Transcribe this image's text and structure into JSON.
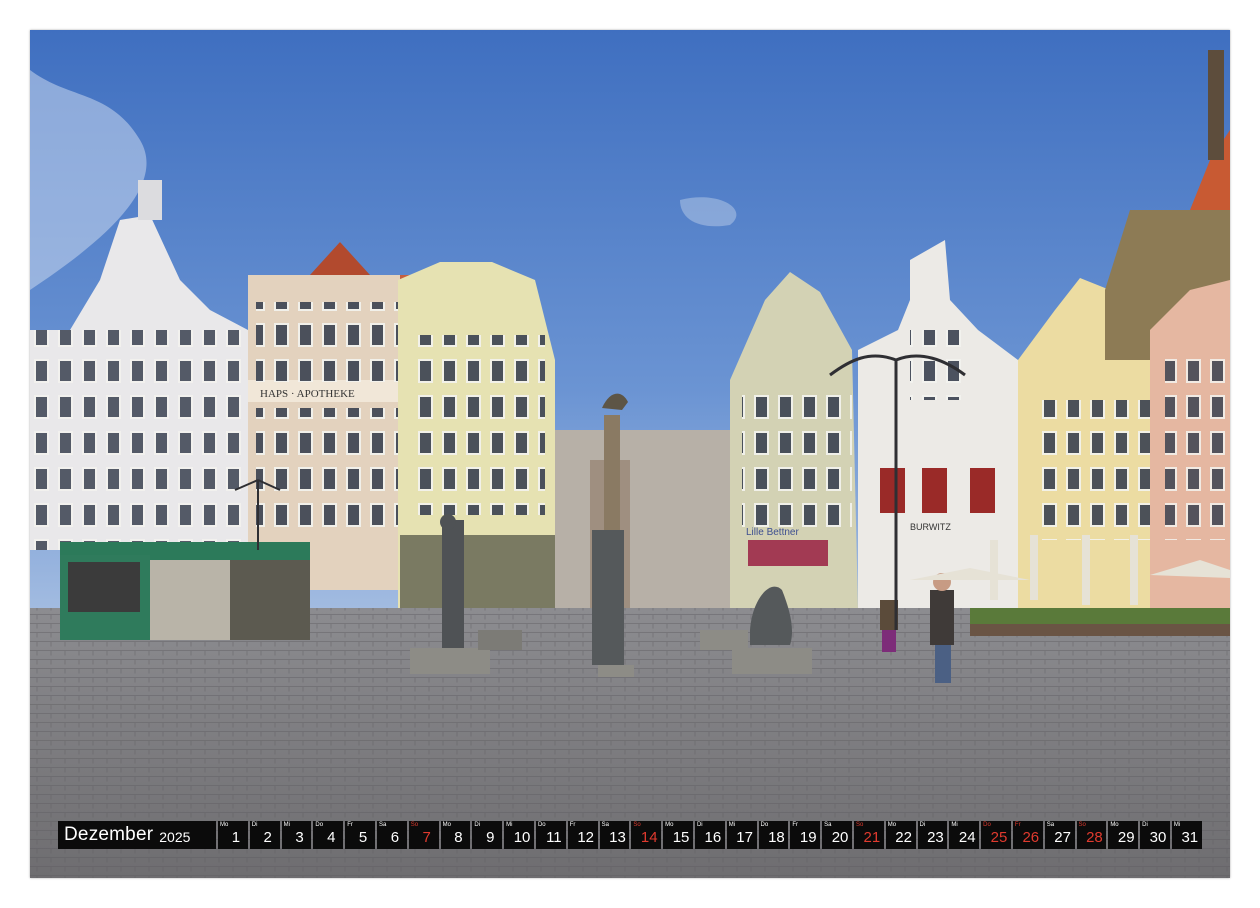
{
  "photo": {
    "scene_icon": "rostock-neuer-markt-photo",
    "shop_signs": [
      "HAPS · APOTHEKE",
      "Lille Bettner",
      "BURWITZ"
    ]
  },
  "calendar": {
    "month": "Dezember",
    "year": "2025",
    "weekend_color": "#e03a2e",
    "days": [
      {
        "wd": "Mo",
        "d": "1"
      },
      {
        "wd": "Di",
        "d": "2"
      },
      {
        "wd": "Mi",
        "d": "3"
      },
      {
        "wd": "Do",
        "d": "4"
      },
      {
        "wd": "Fr",
        "d": "5"
      },
      {
        "wd": "Sa",
        "d": "6"
      },
      {
        "wd": "So",
        "d": "7"
      },
      {
        "wd": "Mo",
        "d": "8"
      },
      {
        "wd": "Di",
        "d": "9"
      },
      {
        "wd": "Mi",
        "d": "10"
      },
      {
        "wd": "Do",
        "d": "11"
      },
      {
        "wd": "Fr",
        "d": "12"
      },
      {
        "wd": "Sa",
        "d": "13"
      },
      {
        "wd": "So",
        "d": "14"
      },
      {
        "wd": "Mo",
        "d": "15"
      },
      {
        "wd": "Di",
        "d": "16"
      },
      {
        "wd": "Mi",
        "d": "17"
      },
      {
        "wd": "Do",
        "d": "18"
      },
      {
        "wd": "Fr",
        "d": "19"
      },
      {
        "wd": "Sa",
        "d": "20"
      },
      {
        "wd": "So",
        "d": "21"
      },
      {
        "wd": "Mo",
        "d": "22"
      },
      {
        "wd": "Di",
        "d": "23"
      },
      {
        "wd": "Mi",
        "d": "24"
      },
      {
        "wd": "Do",
        "d": "25"
      },
      {
        "wd": "Fr",
        "d": "26"
      },
      {
        "wd": "Sa",
        "d": "27"
      },
      {
        "wd": "So",
        "d": "28"
      },
      {
        "wd": "Mo",
        "d": "29"
      },
      {
        "wd": "Di",
        "d": "30"
      },
      {
        "wd": "Mi",
        "d": "31"
      }
    ],
    "highlighted_days": [
      "7",
      "14",
      "21",
      "25",
      "26",
      "28"
    ]
  }
}
